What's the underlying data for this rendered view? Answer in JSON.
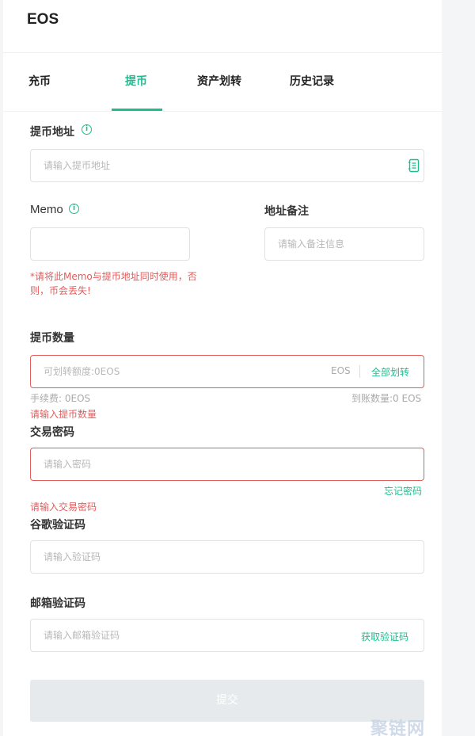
{
  "header": {
    "title": "EOS"
  },
  "tabs": [
    {
      "label": "充币",
      "active": false
    },
    {
      "label": "提币",
      "active": true
    },
    {
      "label": "资产划转",
      "active": false
    },
    {
      "label": "历史记录",
      "active": false
    }
  ],
  "form": {
    "address": {
      "label": "提币地址",
      "placeholder": "请输入提币地址"
    },
    "memo": {
      "label": "Memo",
      "placeholder": "",
      "warning": "*请将此Memo与提币地址同时使用，否则，币会丢失!"
    },
    "remark": {
      "label": "地址备注",
      "placeholder": "请输入备注信息"
    },
    "amount": {
      "label": "提币数量",
      "placeholder": "可划转额度:0EOS",
      "unit": "EOS",
      "transfer_all": "全部划转",
      "fee": "手续费: 0EOS",
      "received": "到账数量:0 EOS",
      "error": "请输入提币数量"
    },
    "password": {
      "label": "交易密码",
      "placeholder": "请输入密码",
      "forgot": "忘记密码",
      "error": "请输入交易密码"
    },
    "google_code": {
      "label": "谷歌验证码",
      "placeholder": "请输入验证码"
    },
    "email_code": {
      "label": "邮箱验证码",
      "placeholder": "请输入邮箱验证码",
      "get_code": "获取验证码"
    },
    "submit_label": "提交"
  },
  "watermark": "聚链网",
  "colors": {
    "accent": "#1ebc8f",
    "error": "#e25c5c",
    "disabled": "#e7eaec"
  }
}
